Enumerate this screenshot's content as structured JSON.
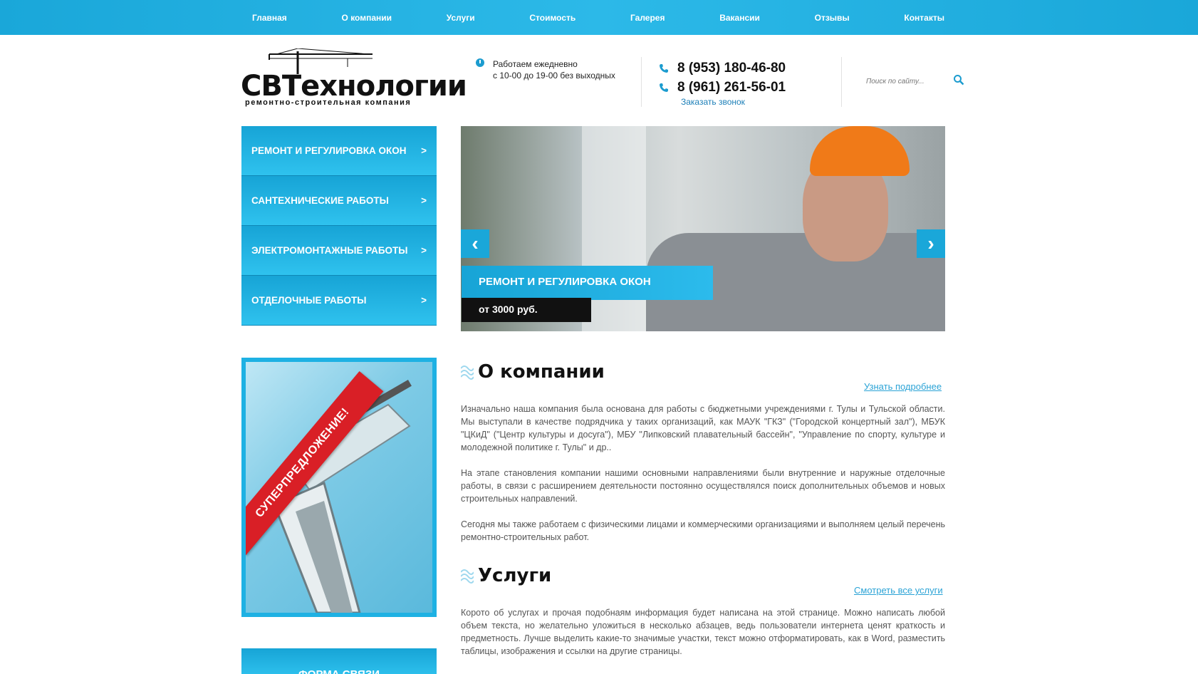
{
  "nav": {
    "items": [
      "Главная",
      "О компании",
      "Услуги",
      "Стоимость",
      "Галерея",
      "Вакансии",
      "Отзывы",
      "Контакты"
    ]
  },
  "header": {
    "logo_main": "СВТехнологии",
    "logo_sub": "ремонтно-строительная компания",
    "hours_line1": "Работаем ежедневно",
    "hours_line2": "с 10-00 до 19-00 без выходных",
    "phone1": "8 (953) 180-46-80",
    "phone2": "8 (961) 261-56-01",
    "callback": "Заказать звонок",
    "search_placeholder": "Поиск по сайту..."
  },
  "leftmenu": {
    "items": [
      "РЕМОНТ И РЕГУЛИРОВКА ОКОН",
      "САНТЕХНИЧЕСКИЕ РАБОТЫ",
      "ЭЛЕКТРОМОНТАЖНЫЕ РАБОТЫ",
      "ОТДЕЛОЧНЫЕ РАБОТЫ"
    ],
    "arrow": ">"
  },
  "promo": {
    "ribbon": "СУПЕРПРЕДЛОЖЕНИЕ!"
  },
  "contactform": {
    "title": "ФОРМА СВЯЗИ"
  },
  "slider": {
    "title": "РЕМОНТ И РЕГУЛИРОВКА ОКОН",
    "price": "от 3000 руб.",
    "prev": "‹",
    "next": "›"
  },
  "about": {
    "title": "О компании",
    "more": "Узнать подробнее",
    "p1": "Изначально наша компания была основана для работы с бюджетными учреждениями г. Тулы и Тульской области. Мы выступали в качестве подрядчика у таких организаций, как МАУК \"ГКЗ\" (\"Городской концертный зал\"), МБУК \"ЦКиД\" (\"Центр культуры и досуга\"), МБУ \"Липковский плавательный бассейн\", \"Управление по спорту, культуре и молодежной политике г. Тулы\" и др..",
    "p2": "На этапе становления компании нашими основными направлениями были внутренние и наружные отделочные работы, в связи с расширением деятельности постоянно осуществлялся поиск дополнительных объемов и новых строительных направлений.",
    "p3": "Сегодня мы также работаем с физическими лицами и коммерческими организациями и выполняем целый перечень ремонтно-строительных работ."
  },
  "services": {
    "title": "Услуги",
    "more": "Смотреть все услуги",
    "p1": "Корото об услугах и прочая подобнаям информация будет написана на этой странице. Можно написать любой объем текста, но желательно уложиться в несколько абзацев, ведь пользователи интернета ценят краткость и предметность. Лучше выделить какие-то значимые участки, текст можно отформатировать, как в Word, разместить таблицы, изображения и ссылки на другие страницы."
  }
}
